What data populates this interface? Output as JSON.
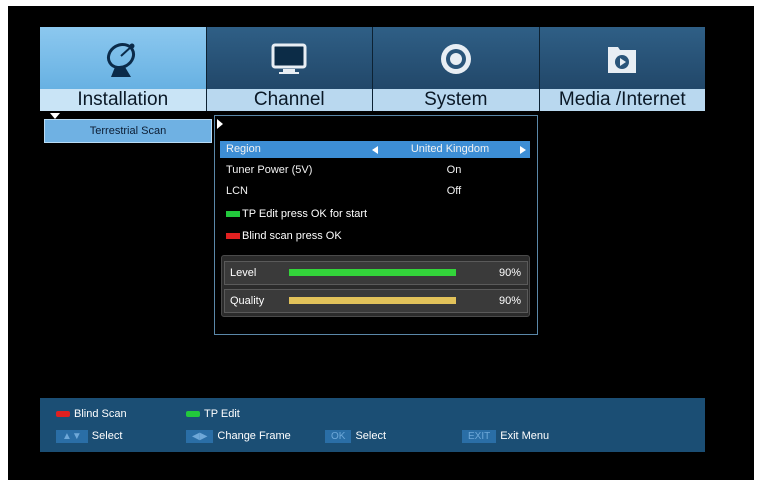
{
  "tabs": [
    {
      "label": "Installation",
      "icon": "satellite-dish-icon",
      "active": true
    },
    {
      "label": "Channel",
      "icon": "monitor-icon",
      "active": false
    },
    {
      "label": "System",
      "icon": "gear-icon",
      "active": false
    },
    {
      "label": "Media /Internet",
      "icon": "media-folder-icon",
      "active": false
    }
  ],
  "left_menu": {
    "item": "Terrestrial Scan"
  },
  "settings": {
    "region_label": "Region",
    "region_value": "United Kingdom",
    "tuner_power_label": "Tuner Power (5V)",
    "tuner_power_value": "On",
    "lcn_label": "LCN",
    "lcn_value": "Off"
  },
  "hints": {
    "tp_edit": "TP Edit press OK for start",
    "blind_scan": "Blind scan press OK"
  },
  "signal": {
    "level_label": "Level",
    "level_value": 90,
    "level_text": "90%",
    "quality_label": "Quality",
    "quality_value": 90,
    "quality_text": "90%"
  },
  "footer": {
    "blind_scan": "Blind Scan",
    "tp_edit": "TP Edit",
    "select1": "Select",
    "change_frame": "Change Frame",
    "ok_key": "OK",
    "select2": "Select",
    "exit_key": "EXIT",
    "exit_menu": "Exit Menu"
  },
  "colors": {
    "red_key": "#e02020",
    "green_key": "#22c83c",
    "level_bar": "#33d43a",
    "quality_bar": "#e2c25a",
    "highlight": "#3d8ed5"
  }
}
